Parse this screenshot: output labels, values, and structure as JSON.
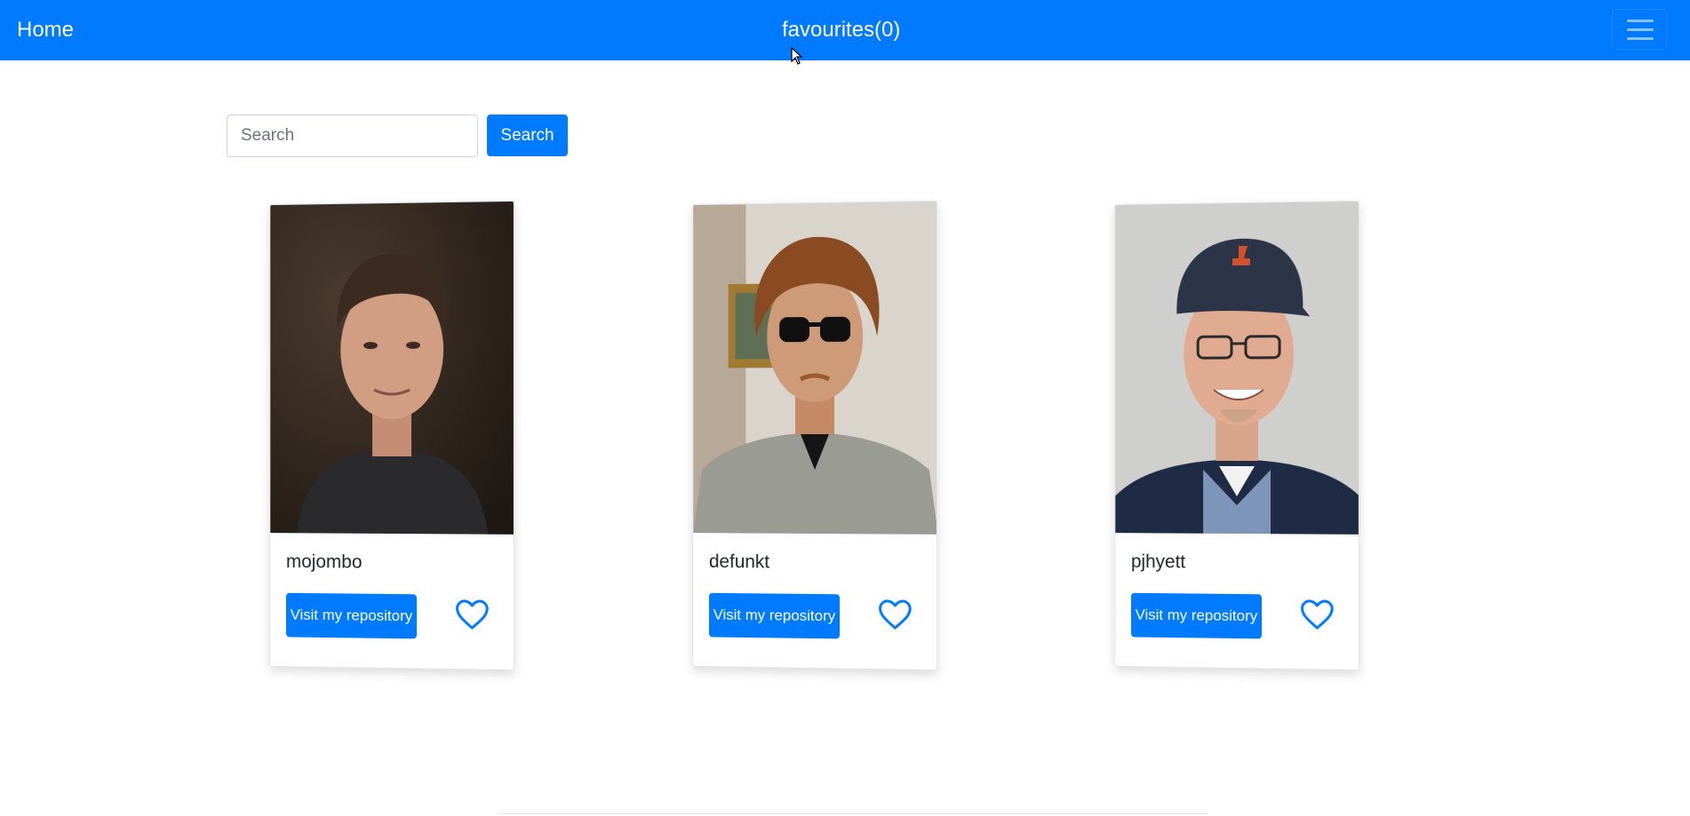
{
  "navbar": {
    "home_label": "Home",
    "favourites_label": "favourites(0)",
    "background_color": "#007bff",
    "toggler_icon": "hamburger-menu-icon"
  },
  "search": {
    "placeholder": "Search",
    "value": "",
    "button_label": "Search"
  },
  "cards": [
    {
      "username": "mojombo",
      "button_label": "Visit my repository",
      "favourite_icon": "heart-outline-icon"
    },
    {
      "username": "defunkt",
      "button_label": "Visit my repository",
      "favourite_icon": "heart-outline-icon"
    },
    {
      "username": "pjhyett",
      "button_label": "Visit my repository",
      "favourite_icon": "heart-outline-icon"
    }
  ],
  "colors": {
    "accent": "#007bff",
    "text": "#212529"
  }
}
